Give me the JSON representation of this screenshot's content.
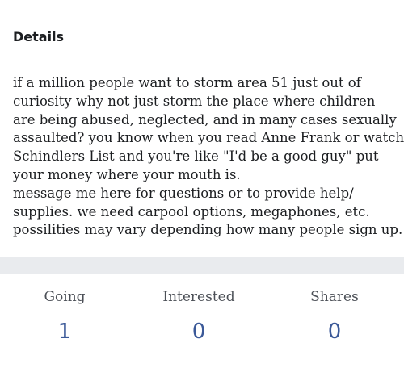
{
  "details": {
    "title": "Details",
    "lines": [
      "if a million people want to storm area 51 just out of",
      "curiosity why not just storm the place where children",
      "are being abused, neglected, and in many cases sexually",
      "assaulted? you know when you read Anne Frank or watch",
      "Schindlers List and you're like \"I'd be a good guy\" put",
      "your money where your mouth is.",
      "message me here for questions or to provide help/",
      "supplies. we need carpool options, megaphones, etc.",
      "possilities may vary depending how many people sign up."
    ]
  },
  "stats": {
    "going": {
      "label": "Going",
      "value": "1"
    },
    "interested": {
      "label": "Interested",
      "value": "0"
    },
    "shares": {
      "label": "Shares",
      "value": "0"
    }
  }
}
